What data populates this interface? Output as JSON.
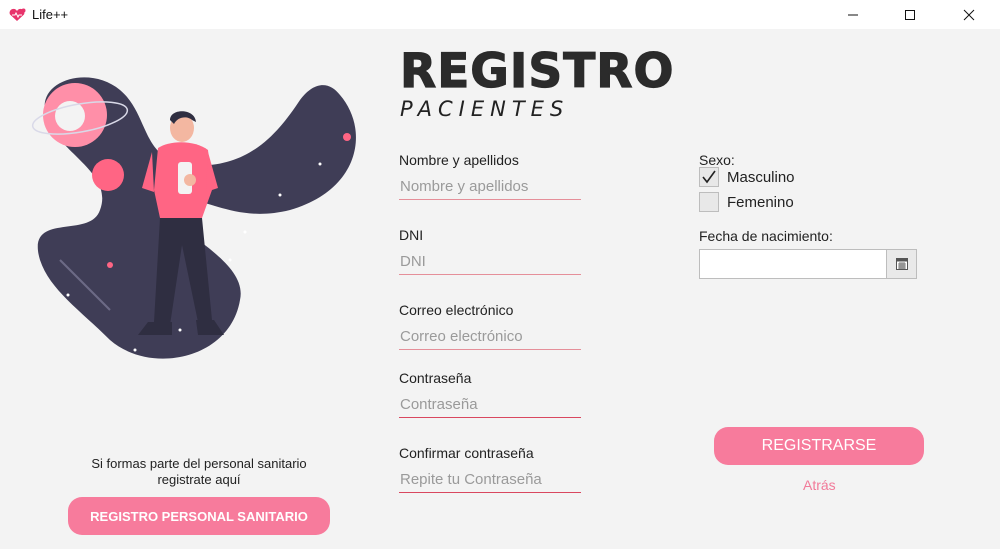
{
  "window": {
    "title": "Life++",
    "icon": "heart-icon",
    "controls": [
      "minimize-icon",
      "maximize-icon",
      "close-icon"
    ]
  },
  "header": {
    "title": "REGISTRO",
    "subtitle": "PACIENTES"
  },
  "form": {
    "name": {
      "label": "Nombre y apellidos",
      "placeholder": "Nombre y apellidos",
      "value": ""
    },
    "dni": {
      "label": "DNI",
      "placeholder": "DNI",
      "value": ""
    },
    "email": {
      "label": "Correo electrónico",
      "placeholder": "Correo electrónico",
      "value": ""
    },
    "password": {
      "label": "Contraseña",
      "placeholder": "Contraseña",
      "value": ""
    },
    "confirm": {
      "label": "Confirmar contraseña",
      "placeholder": "Repite tu Contraseña",
      "value": ""
    }
  },
  "sex": {
    "label": "Sexo:",
    "options": [
      {
        "label": "Masculino",
        "checked": true
      },
      {
        "label": "Femenino",
        "checked": false
      }
    ]
  },
  "birthdate": {
    "label": "Fecha de nacimiento:",
    "value": "",
    "icon": "calendar-icon"
  },
  "actions": {
    "register": "REGISTRARSE",
    "back": "Atrás"
  },
  "staff": {
    "text_line1": "Si formas parte del personal sanitario",
    "text_line2": "registrate aquí",
    "button": "REGISTRO PERSONAL SANITARIO"
  },
  "colors": {
    "accent": "#f77b9c",
    "underline": "#e58f99",
    "illustration_dark": "#3f3d56",
    "illustration_pink": "#ff6584",
    "background": "#f3f3f3"
  }
}
